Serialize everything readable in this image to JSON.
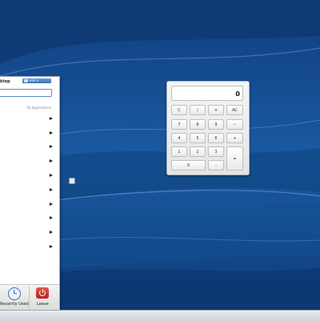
{
  "colors": {
    "desktop": "#0f3f7c",
    "accent": "#2e6db4",
    "leave": "#c8342a"
  },
  "launcher": {
    "title": "ktop",
    "brand_label": "KDE 4 DESKTOP",
    "search": {
      "value": "",
      "placeholder": ""
    },
    "section_label": "All Applications",
    "category_count_visible": 10,
    "tabs": [
      {
        "label": "Recently Used",
        "icon": "clock-icon"
      },
      {
        "label": "Leave",
        "icon": "power-icon"
      }
    ]
  },
  "calculator": {
    "display": "0",
    "keys": [
      [
        "C",
        "/",
        "×",
        "AC"
      ],
      [
        "7",
        "8",
        "9",
        "−"
      ],
      [
        "4",
        "5",
        "6",
        "+"
      ],
      [
        "1",
        "2",
        "3",
        "="
      ],
      [
        "0",
        "."
      ]
    ]
  }
}
